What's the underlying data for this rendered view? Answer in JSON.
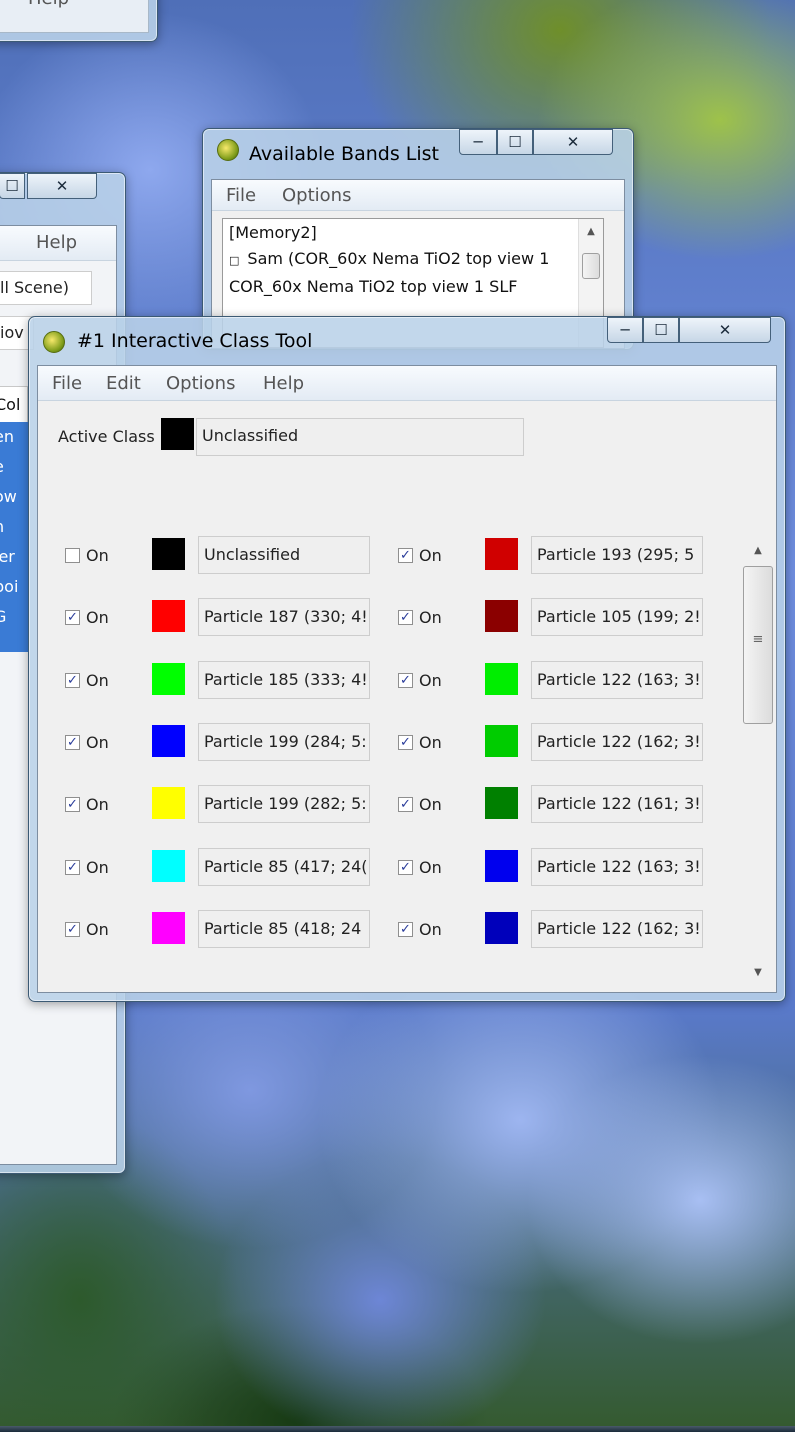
{
  "bg_window_top": {
    "menu": [
      "Help"
    ]
  },
  "bg_window_left": {
    "menu": [
      "Help"
    ],
    "fields": [
      "ll Scene)",
      "iov"
    ],
    "list_header": "Col",
    "list_items": [
      "en",
      "e",
      "ow",
      "n",
      "jer",
      "poi",
      "G"
    ]
  },
  "bands_window": {
    "title": "Available Bands List",
    "menu": [
      "File",
      "Options"
    ],
    "items": [
      "[Memory2]",
      "Sam (COR_60x Nema TiO2 top view 1",
      "COR_60x Nema TiO2 top view 1 SLF"
    ]
  },
  "class_window": {
    "title": "#1 Interactive Class Tool",
    "menu": [
      "File",
      "Edit",
      "Options",
      "Help"
    ],
    "active_class_label": "Active Class",
    "active_class_value": "Unclassified",
    "active_class_color": "#000000",
    "on_label": "On",
    "rows": [
      [
        {
          "checked": false,
          "color": "#000000",
          "name": "Unclassified"
        },
        {
          "checked": true,
          "color": "#d00000",
          "name": "Particle 193 (295; 5"
        }
      ],
      [
        {
          "checked": true,
          "color": "#ff0000",
          "name": "Particle 187 (330; 4!"
        },
        {
          "checked": true,
          "color": "#8b0000",
          "name": "Particle 105 (199; 2!"
        }
      ],
      [
        {
          "checked": true,
          "color": "#00ff00",
          "name": "Particle 185 (333; 4!"
        },
        {
          "checked": true,
          "color": "#00ee00",
          "name": "Particle 122 (163; 3!"
        }
      ],
      [
        {
          "checked": true,
          "color": "#0000ff",
          "name": "Particle 199 (284; 5:"
        },
        {
          "checked": true,
          "color": "#00cc00",
          "name": "Particle 122 (162; 3!"
        }
      ],
      [
        {
          "checked": true,
          "color": "#ffff00",
          "name": "Particle 199 (282; 5:"
        },
        {
          "checked": true,
          "color": "#008000",
          "name": "Particle 122 (161; 3!"
        }
      ],
      [
        {
          "checked": true,
          "color": "#00ffff",
          "name": "Particle 85 (417; 24("
        },
        {
          "checked": true,
          "color": "#0000ee",
          "name": "Particle 122 (163; 3!"
        }
      ],
      [
        {
          "checked": true,
          "color": "#ff00ff",
          "name": "Particle 85 (418; 24"
        },
        {
          "checked": true,
          "color": "#0000bb",
          "name": "Particle 122 (162; 3!"
        }
      ]
    ]
  },
  "icons": {
    "minimize": "─",
    "maximize": "☐",
    "close": "✕",
    "check": "✓",
    "scroll_up": "▲",
    "scroll_down": "▼",
    "grip": "≡"
  }
}
